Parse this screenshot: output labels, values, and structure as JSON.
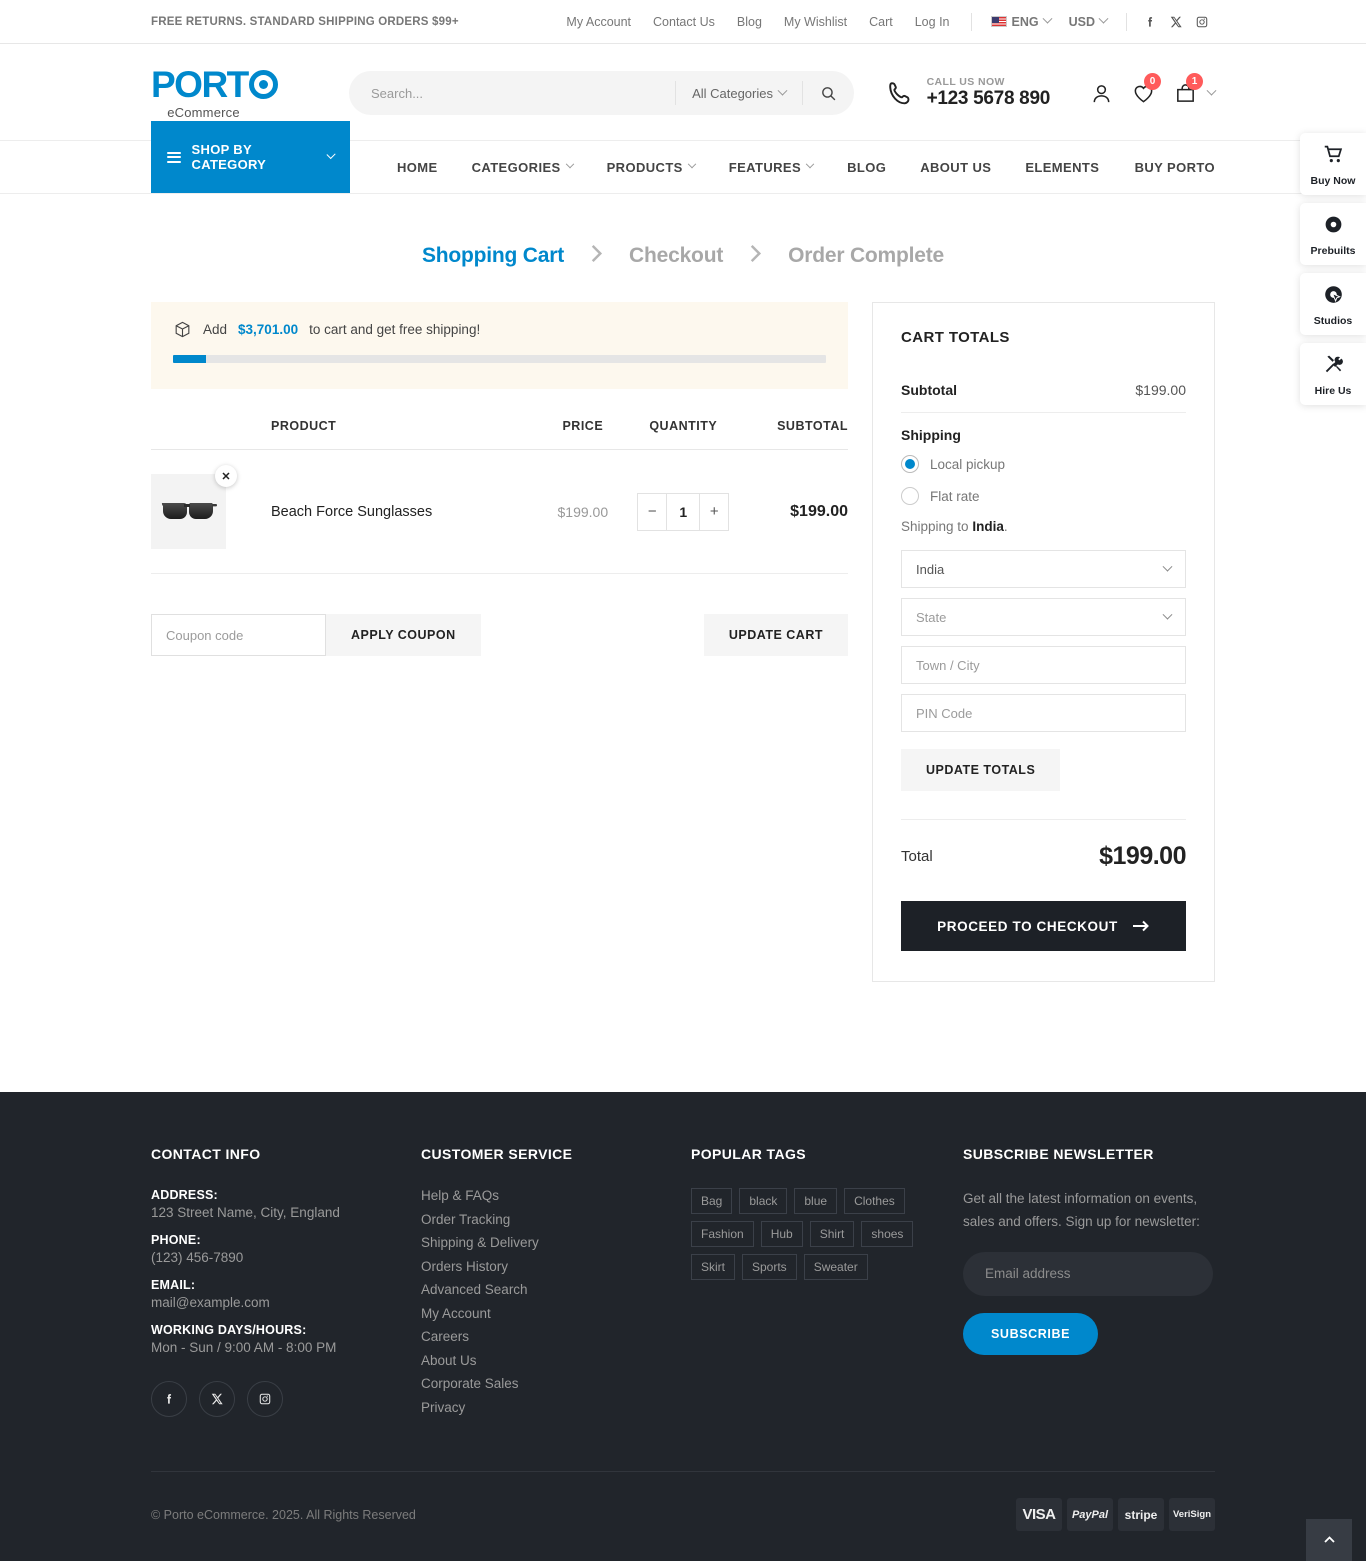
{
  "topbar": {
    "promo": "FREE RETURNS. STANDARD SHIPPING ORDERS $99+",
    "links": [
      {
        "label": "My Account"
      },
      {
        "label": "Contact Us"
      },
      {
        "label": "Blog"
      },
      {
        "label": "My Wishlist"
      },
      {
        "label": "Cart"
      },
      {
        "label": "Log In"
      }
    ],
    "language": "ENG",
    "currency": "USD",
    "socials": [
      "facebook-icon",
      "x-twitter-icon",
      "instagram-icon"
    ]
  },
  "header": {
    "logo_main": "PORT",
    "logo_sub": "eCommerce",
    "search_placeholder": "Search...",
    "search_value": "",
    "search_category": "All Categories",
    "call_label": "CALL US NOW",
    "call_number": "+123 5678 890",
    "wishlist_count": "0",
    "cart_count": "1"
  },
  "nav": {
    "shop_by_category": "SHOP BY CATEGORY",
    "items": [
      {
        "label": "HOME",
        "has_caret": false
      },
      {
        "label": "CATEGORIES",
        "has_caret": true
      },
      {
        "label": "PRODUCTS",
        "has_caret": true
      },
      {
        "label": "FEATURES",
        "has_caret": true
      },
      {
        "label": "BLOG",
        "has_caret": false
      },
      {
        "label": "ABOUT US",
        "has_caret": false
      },
      {
        "label": "ELEMENTS",
        "has_caret": false
      }
    ],
    "buy_porto": "BUY PORTO"
  },
  "steps": [
    {
      "label": "Shopping Cart",
      "active": true
    },
    {
      "label": "Checkout",
      "active": false
    },
    {
      "label": "Order Complete",
      "active": false
    }
  ],
  "free_shipping": {
    "prefix": "Add",
    "amount": "$3,701.00",
    "suffix": "to cart and get free shipping!",
    "progress_percent": 5
  },
  "cart_table": {
    "headers": {
      "product": "PRODUCT",
      "price": "PRICE",
      "quantity": "QUANTITY",
      "subtotal": "SUBTOTAL"
    },
    "rows": [
      {
        "name": "Beach Force Sunglasses",
        "price": "$199.00",
        "quantity": "1",
        "subtotal": "$199.00",
        "remove_label": "✕",
        "minus_label": "−",
        "plus_label": "+",
        "image": "sunglasses-thumbnail"
      }
    ]
  },
  "coupon": {
    "placeholder": "Coupon code",
    "value": "",
    "apply_label": "APPLY COUPON",
    "update_cart_label": "UPDATE CART"
  },
  "cart_totals": {
    "title": "CART TOTALS",
    "subtotal_label": "Subtotal",
    "subtotal_value": "$199.00",
    "shipping_label": "Shipping",
    "shipping_options": [
      {
        "label": "Local pickup",
        "selected": true
      },
      {
        "label": "Flat rate",
        "selected": false
      }
    ],
    "shipping_to_prefix": "Shipping to",
    "shipping_to_country": "India",
    "shipping_to_suffix": ".",
    "country_value": "India",
    "state_placeholder": "State",
    "city_placeholder": "Town / City",
    "pin_placeholder": "PIN Code",
    "update_totals_label": "UPDATE TOTALS",
    "total_label": "Total",
    "total_value": "$199.00",
    "checkout_label": "PROCEED TO CHECKOUT"
  },
  "side_widget": [
    {
      "label": "Buy Now",
      "icon": "shopping-cart-icon"
    },
    {
      "label": "Prebuilts",
      "icon": "disc-icon"
    },
    {
      "label": "Studios",
      "icon": "cursor-target-icon"
    },
    {
      "label": "Hire Us",
      "icon": "tools-icon"
    }
  ],
  "footer": {
    "contact": {
      "title": "CONTACT INFO",
      "blocks": [
        {
          "key": "ADDRESS:",
          "value": "123 Street Name, City, England"
        },
        {
          "key": "PHONE:",
          "value": "(123) 456-7890"
        },
        {
          "key": "EMAIL:",
          "value": "mail@example.com"
        },
        {
          "key": "WORKING DAYS/HOURS:",
          "value": "Mon - Sun / 9:00 AM - 8:00 PM"
        }
      ],
      "socials": [
        "facebook-icon",
        "x-twitter-icon",
        "instagram-icon"
      ]
    },
    "customer_service": {
      "title": "CUSTOMER SERVICE",
      "links": [
        "Help & FAQs",
        "Order Tracking",
        "Shipping & Delivery",
        "Orders History",
        "Advanced Search",
        "My Account",
        "Careers",
        "About Us",
        "Corporate Sales",
        "Privacy"
      ]
    },
    "popular_tags": {
      "title": "POPULAR TAGS",
      "tags": [
        "Bag",
        "black",
        "blue",
        "Clothes",
        "Fashion",
        "Hub",
        "Shirt",
        "shoes",
        "Skirt",
        "Sports",
        "Sweater"
      ]
    },
    "newsletter": {
      "title": "SUBSCRIBE NEWSLETTER",
      "text": "Get all the latest information on events, sales and offers. Sign up for newsletter:",
      "placeholder": "Email address",
      "value": "",
      "button": "SUBSCRIBE"
    },
    "copyright": "© Porto eCommerce. 2025. All Rights Reserved",
    "paycards": [
      "VISA",
      "PayPal",
      "stripe",
      "VeriSign"
    ]
  },
  "colors": {
    "accent": "#0088cc",
    "dark": "#21252b",
    "badge": "#ff5b5b"
  }
}
